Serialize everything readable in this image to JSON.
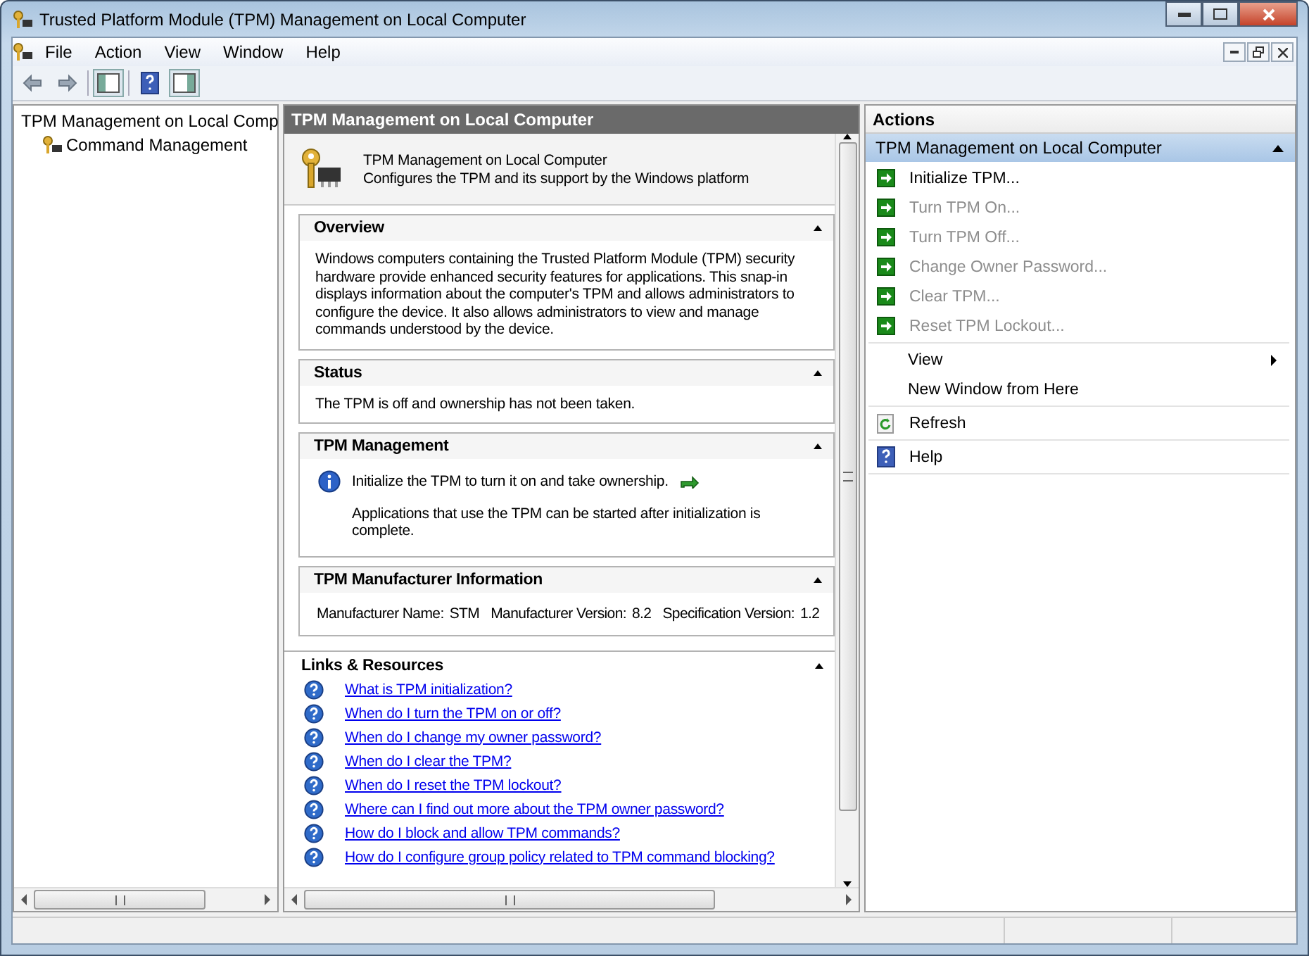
{
  "window": {
    "title": "Trusted Platform Module (TPM) Management on Local Computer"
  },
  "menu": [
    {
      "label": "File"
    },
    {
      "label": "Action"
    },
    {
      "label": "View"
    },
    {
      "label": "Window"
    },
    {
      "label": "Help"
    }
  ],
  "tree": [
    {
      "label": "TPM Management on Local Comp",
      "selected": false,
      "children": [
        {
          "label": "Command Management",
          "selected": false
        }
      ]
    }
  ],
  "center": {
    "title": "TPM Management on Local Computer",
    "banner": {
      "title": "TPM Management on Local Computer",
      "description": "Configures the TPM and its support by the Windows platform"
    },
    "sections": [
      {
        "kind": "text",
        "title": "Overview",
        "expanded": true,
        "text": "Windows computers containing the Trusted Platform Module (TPM) security hardware provide enhanced security features for applications. This snap-in displays information about the computer's TPM and allows administrators to configure the device. It also allows administrators to view and manage commands understood by the device."
      },
      {
        "kind": "text",
        "title": "Status",
        "expanded": true,
        "text": "The TPM is off and ownership has not been taken."
      },
      {
        "kind": "info",
        "title": "TPM Management",
        "expanded": true,
        "text": "Initialize the TPM to turn it on and take ownership.",
        "note": "Applications that use the TPM can be started after initialization is complete."
      },
      {
        "kind": "fields",
        "title": "TPM Manufacturer Information",
        "expanded": true,
        "fields": [
          {
            "label": "Manufacturer Name:",
            "value": "STM"
          },
          {
            "label": "Manufacturer Version:",
            "value": "8.2"
          },
          {
            "label": "Specification Version:",
            "value": "1.2"
          }
        ]
      }
    ],
    "links": {
      "title": "Links & Resources",
      "expanded": true,
      "items": [
        "What is TPM initialization?",
        "When do I turn the TPM on or off?",
        "When do I change my owner password?",
        "When do I clear the TPM?",
        "When do I reset the TPM lockout?",
        "Where can I find out more about the TPM owner password?",
        "How do I block and allow TPM commands?",
        "How do I configure group policy related to TPM command blocking?"
      ]
    }
  },
  "actions": {
    "title": "Actions",
    "group_title": "TPM Management on Local Computer",
    "expanded": true,
    "groups": [
      [
        {
          "kind": "command",
          "label": "Initialize TPM...",
          "disabled": false
        },
        {
          "kind": "command",
          "label": "Turn TPM On...",
          "disabled": true
        },
        {
          "kind": "command",
          "label": "Turn TPM Off...",
          "disabled": true
        },
        {
          "kind": "command",
          "label": "Change Owner Password...",
          "disabled": true
        },
        {
          "kind": "command",
          "label": "Clear TPM...",
          "disabled": true
        },
        {
          "kind": "command",
          "label": "Reset TPM Lockout...",
          "disabled": true
        }
      ],
      [
        {
          "kind": "submenu",
          "label": "View",
          "disabled": false
        },
        {
          "kind": "plain",
          "label": "New Window from Here",
          "disabled": false
        }
      ],
      [
        {
          "kind": "refresh",
          "label": "Refresh",
          "disabled": false
        }
      ],
      [
        {
          "kind": "help",
          "label": "Help",
          "disabled": false
        }
      ]
    ]
  }
}
